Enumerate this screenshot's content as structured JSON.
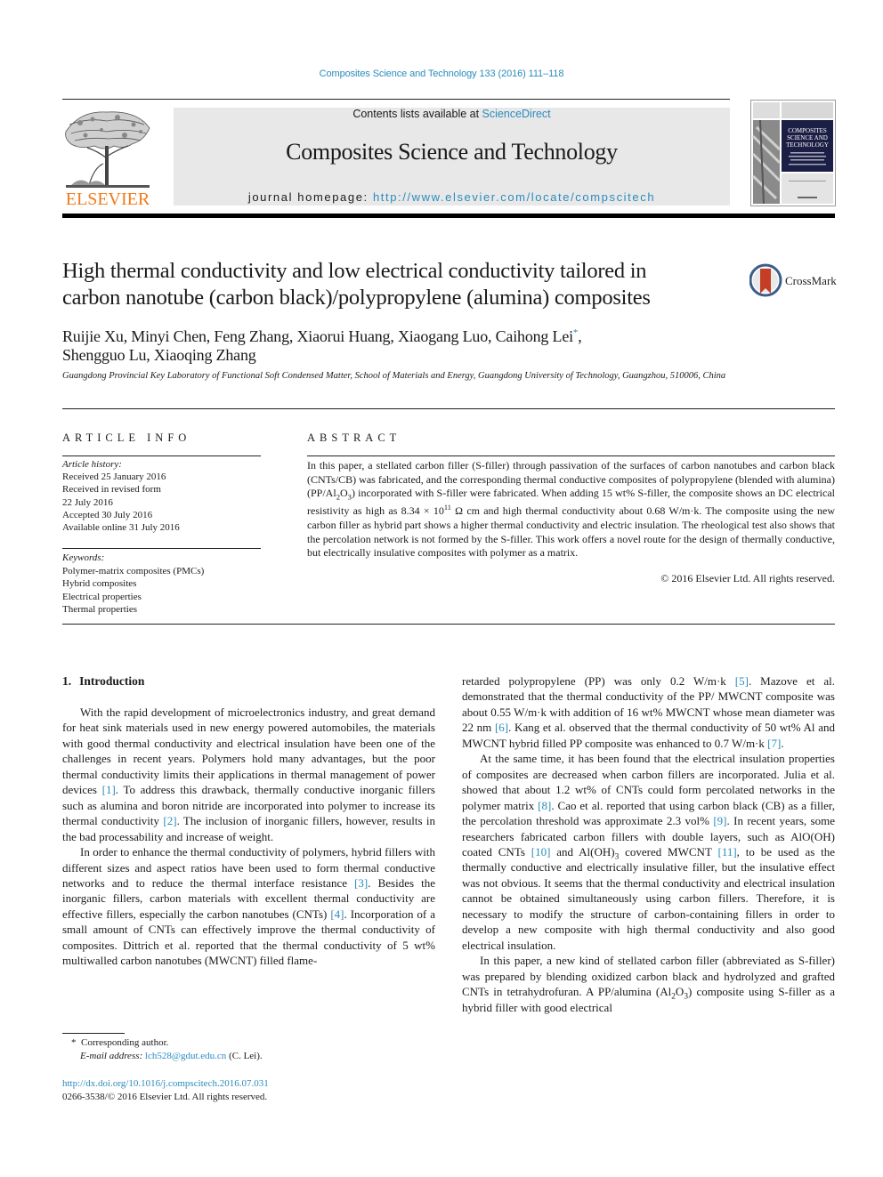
{
  "running_head": "Composites Science and Technology 133 (2016) 111–118",
  "masthead": {
    "contents_prefix": "Contents lists available at ",
    "contents_link": "ScienceDirect",
    "journal_title": "Composites Science and Technology",
    "homepage_prefix": "journal homepage: ",
    "homepage_url": "http://www.elsevier.com/locate/compscitech",
    "publisher_logo_text": "ELSEVIER",
    "cover_title_lines": [
      "COMPOSITES",
      "SCIENCE AND",
      "TECHNOLOGY"
    ]
  },
  "article": {
    "title_line1": "High thermal conductivity and low electrical conductivity tailored in",
    "title_line2": "carbon nanotube (carbon black)/polypropylene (alumina) composites",
    "crossmark_label": "CrossMark",
    "authors_line1": "Ruijie Xu, Minyi Chen, Feng Zhang, Xiaorui Huang, Xiaogang Luo, Caihong Lei",
    "corresponding_mark": "*",
    "authors_line1_end": ",",
    "authors_line2": "Shengguo Lu, Xiaoqing Zhang",
    "affiliation": "Guangdong Provincial Key Laboratory of Functional Soft Condensed Matter, School of Materials and Energy, Guangdong University of Technology, Guangzhou, 510006, China"
  },
  "article_info": {
    "heading": "ARTICLE INFO",
    "history_heading": "Article history:",
    "history": [
      "Received 25 January 2016",
      "Received in revised form",
      "22 July 2016",
      "Accepted 30 July 2016",
      "Available online 31 July 2016"
    ],
    "keywords_heading": "Keywords:",
    "keywords": [
      "Polymer-matrix composites (PMCs)",
      "Hybrid composites",
      "Electrical properties",
      "Thermal properties"
    ]
  },
  "abstract": {
    "heading": "ABSTRACT",
    "part1": "In this paper, a stellated carbon filler (S-filler) through passivation of the surfaces of carbon nanotubes and carbon black (CNTs/CB) was fabricated, and the corresponding thermal conductive composites of polypropylene (blended with alumina) (PP/Al",
    "sub1": "2",
    "part2": "O",
    "sub2": "3",
    "part3": ") incorporated with S-filler were fabricated. When adding 15 wt% S-filler, the composite shows an DC electrical resistivity as high as 8.34 × 10",
    "sup1": "11",
    "part4": " Ω cm and high thermal conductivity about 0.68 W/m·k. The composite using the new carbon filler as hybrid part shows a higher thermal conductivity and electric insulation. The rheological test also shows that the percolation network is not formed by the S-filler. This work offers a novel route for the design of thermally conductive, but electrically insulative composites with polymer as a matrix.",
    "copyright": "© 2016 Elsevier Ltd. All rights reserved."
  },
  "body": {
    "section_number": "1.",
    "section_title": "Introduction",
    "left": {
      "p1_a": "With the rapid development of microelectronics industry, and great demand for heat sink materials used in new energy powered automobiles, the materials with good thermal conductivity and electrical insulation have been one of the challenges in recent years. Polymers hold many advantages, but the poor thermal conductivity limits their applications in thermal management of power devices ",
      "ref1": "[1]",
      "p1_b": ". To address this drawback, thermally conductive inorganic fillers such as alumina and boron nitride are incorporated into polymer to increase its thermal conductivity ",
      "ref2": "[2]",
      "p1_c": ". The inclusion of inorganic fillers, however, results in the bad processability and increase of weight.",
      "p2_a": "In order to enhance the thermal conductivity of polymers, hybrid fillers with different sizes and aspect ratios have been used to form thermal conductive networks and to reduce the thermal interface resistance ",
      "ref3": "[3]",
      "p2_b": ". Besides the inorganic fillers, carbon mate­rials with excellent thermal conductivity are effective fillers, especially the carbon nanotubes (CNTs) ",
      "ref4": "[4]",
      "p2_c": ". Incorporation of a small amount of CNTs can effectively improve the thermal conductivity of composites. Dittrich et al. reported that the thermal conductivity of 5 wt% multiwalled carbon nanotubes (MWCNT) filled flame-"
    },
    "right": {
      "p1_a": "retarded polypropylene (PP) was only 0.2 W/m·k ",
      "ref5": "[5]",
      "p1_b": ". Mazove et al. demonstrated that the thermal conductivity of the PP/ MWCNT composite was about 0.55 W/m·k with addition of 16 wt% MWCNT whose mean diameter was 22 nm ",
      "ref6": "[6]",
      "p1_c": ". Kang et al. observed that the thermal conductivity of 50 wt% Al and MWCNT hybrid filled PP composite was enhanced to 0.7 W/m·k ",
      "ref7": "[7]",
      "p1_d": ".",
      "p2_a": "At the same time, it has been found that the electrical insulation properties of composites are decreased when carbon fillers are incorporated. Julia et al. showed that about 1.2 wt% of CNTs could form percolated networks in the polymer matrix ",
      "ref8": "[8]",
      "p2_b": ". Cao et al. re­ported that using carbon black (CB) as a filler, the percolation threshold was approximate 2.3 vol% ",
      "ref9": "[9]",
      "p2_c": ". In recent years, some re­searchers fabricated carbon fillers with double layers, such as AlO(OH) coated CNTs ",
      "ref10": "[10]",
      "p2_d": " and Al(OH)",
      "p2_sub": "3",
      "p2_e": " covered MWCNT ",
      "ref11": "[11]",
      "p2_f": ", to be used as the thermally conductive and electrically insulative filler, but the insulative effect was not obvious. It seems that the thermal conductivity and electrical insulation cannot be obtained simulta­neously using carbon fillers. Therefore, it is necessary to modify the structure of carbon-containing fillers in order to develop a new composite with high thermal conductivity and also good electrical insulation.",
      "p3_a": "In this paper, a new kind of stellated carbon filler (abbreviated as S-filler) was prepared by blending oxidized carbon black and hy­drolyzed and grafted CNTs in tetrahydrofuran. A PP/alumina (Al",
      "p3_sub1": "2",
      "p3_b": "O",
      "p3_sub2": "3",
      "p3_c": ") composite using S-filler as a hybrid filler with good electrical"
    }
  },
  "footnotes": {
    "star": "*",
    "corresponding": "Corresponding author.",
    "email_label": "E-mail address:",
    "email": "lch528@gdut.edu.cn",
    "email_suffix": " (C. Lei).",
    "doi": "http://dx.doi.org/10.1016/j.compscitech.2016.07.031",
    "issn_line": "0266-3538/© 2016 Elsevier Ltd. All rights reserved."
  },
  "colors": {
    "link": "#2a8bbd",
    "elsevier_orange": "#f07b1d",
    "masthead_bg": "#e8e8e8",
    "cover_navy": "#1c1f45"
  }
}
